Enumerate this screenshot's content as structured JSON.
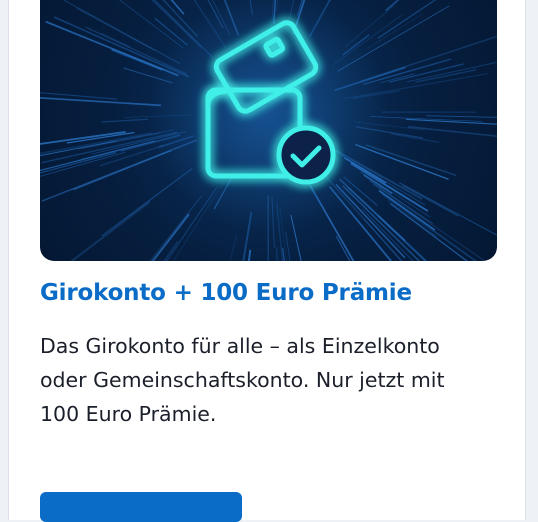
{
  "card": {
    "image": {
      "icon": "wallet-cards-check-icon",
      "glow_color": "#40f0e8",
      "background": "#061e3f"
    },
    "title": "Girokonto + 100 Euro Prämie",
    "description": "Das Girokonto für alle – als Einzelkonto oder Gemeinschaftskonto. Nur jetzt mit 100 Euro Prämie.",
    "cta": {
      "label": "",
      "color": "#0a6cc7"
    }
  },
  "colors": {
    "title": "#0a6cc7",
    "text": "#1b1f2a",
    "page_background": "#eef1f6"
  }
}
